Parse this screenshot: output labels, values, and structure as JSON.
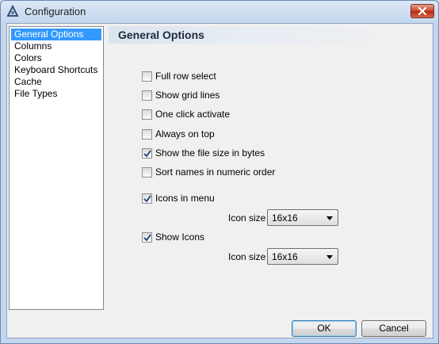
{
  "window": {
    "title": "Configuration",
    "icon": "app-icon",
    "close_icon": "close-icon"
  },
  "sidebar": {
    "items": [
      {
        "label": "General Options",
        "selected": true
      },
      {
        "label": "Columns",
        "selected": false
      },
      {
        "label": "Colors",
        "selected": false
      },
      {
        "label": "Keyboard Shortcuts",
        "selected": false
      },
      {
        "label": "Cache",
        "selected": false
      },
      {
        "label": "File Types",
        "selected": false
      }
    ]
  },
  "panel": {
    "title": "General Options",
    "options": [
      {
        "label": "Full row select",
        "checked": false
      },
      {
        "label": "Show grid lines",
        "checked": false
      },
      {
        "label": "One click activate",
        "checked": false
      },
      {
        "label": "Always on top",
        "checked": false
      },
      {
        "label": "Show the file size in bytes",
        "checked": true
      },
      {
        "label": "Sort names in numeric order",
        "checked": false
      }
    ],
    "icons_in_menu": {
      "label": "Icons in menu",
      "checked": true,
      "size_label": "Icon size",
      "size_value": "16x16"
    },
    "show_icons": {
      "label": "Show Icons",
      "checked": true,
      "size_label": "Icon size",
      "size_value": "16x16"
    }
  },
  "buttons": {
    "ok": "OK",
    "cancel": "Cancel"
  },
  "colors": {
    "selection": "#3399ff",
    "titlebar": "#c2d6ee",
    "close_button": "#c9452a"
  }
}
